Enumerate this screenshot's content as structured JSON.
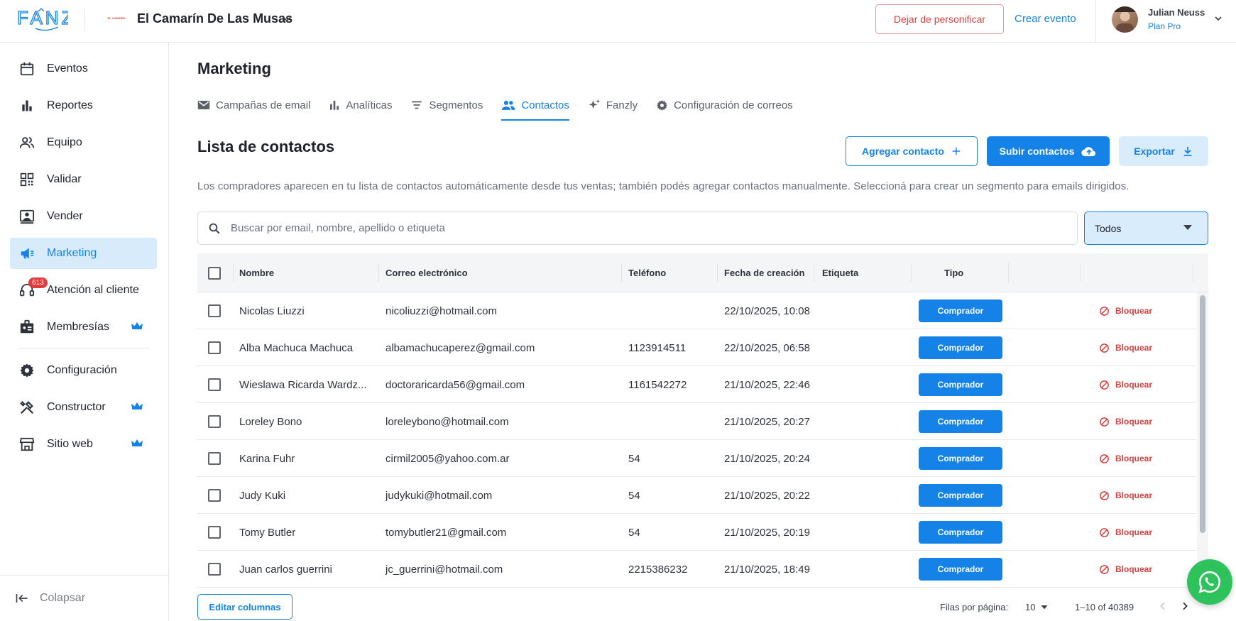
{
  "app": {
    "logo": "FANZ"
  },
  "topbar": {
    "venue_logo_text": "EL CAMARÍN",
    "venue_name": "El Camarín De Las Musas",
    "stop_impersonate_label": "Dejar de personificar",
    "create_event_label": "Crear evento",
    "user_name": "Julian Neuss",
    "user_plan": "Plan Pro"
  },
  "sidebar": {
    "items": [
      {
        "label": "Eventos",
        "icon": "calendar-icon"
      },
      {
        "label": "Reportes",
        "icon": "bar-chart-icon"
      },
      {
        "label": "Equipo",
        "icon": "people-icon"
      },
      {
        "label": "Validar",
        "icon": "qr-code-icon"
      },
      {
        "label": "Vender",
        "icon": "cashier-icon"
      },
      {
        "label": "Marketing",
        "icon": "megaphone-icon",
        "active": true
      },
      {
        "label": "Atención al cliente",
        "icon": "support-icon",
        "badge": "613"
      },
      {
        "label": "Membresías",
        "icon": "badge-icon",
        "crown": true
      },
      {
        "label": "Configuración",
        "icon": "gear-icon"
      },
      {
        "label": "Constructor",
        "icon": "tools-icon",
        "crown": true
      },
      {
        "label": "Sitio web",
        "icon": "store-icon",
        "crown": true
      }
    ],
    "collapse_label": "Colapsar"
  },
  "main": {
    "title": "Marketing",
    "tabs": [
      {
        "label": "Campañas de email",
        "icon": "mail-icon"
      },
      {
        "label": "Analíticas",
        "icon": "bar-chart-icon"
      },
      {
        "label": "Segmentos",
        "icon": "filter-icon"
      },
      {
        "label": "Contactos",
        "icon": "contacts-icon",
        "active": true
      },
      {
        "label": "Fanzly",
        "icon": "sparkle-icon"
      },
      {
        "label": "Configuración de correos",
        "icon": "gear-icon"
      }
    ],
    "section_title": "Lista de contactos",
    "add_contact_label": "Agregar contacto",
    "upload_contacts_label": "Subir contactos",
    "export_label": "Exportar",
    "description": "Los compradores aparecen en tu lista de contactos automáticamente desde tus ventas; también podés agregar contactos manualmente. Seleccioná para crear un segmento para emails dirigidos.",
    "search": {
      "placeholder": "Buscar por email, nombre, apellido o etiqueta",
      "value": ""
    },
    "filter": {
      "selected": "Todos"
    }
  },
  "table": {
    "columns": [
      "Nombre",
      "Correo electrónico",
      "Teléfono",
      "Fecha de creación",
      "Etiqueta",
      "Tipo"
    ],
    "rows": [
      {
        "name": "Nicolas Liuzzi",
        "email": "nicoliuzzi@hotmail.com",
        "phone": "",
        "created": "22/10/2025, 10:08",
        "tag": "",
        "type": "Comprador",
        "action": "Bloquear"
      },
      {
        "name": "Alba Machuca Machuca",
        "email": "albamachucaperez@gmail.com",
        "phone": "1123914511",
        "created": "22/10/2025, 06:58",
        "tag": "",
        "type": "Comprador",
        "action": "Bloquear"
      },
      {
        "name": "Wieslawa Ricarda Wardz...",
        "email": "doctoraricarda56@gmail.com",
        "phone": "1161542272",
        "created": "21/10/2025, 22:46",
        "tag": "",
        "type": "Comprador",
        "action": "Bloquear"
      },
      {
        "name": "Loreley Bono",
        "email": "loreleybono@hotmail.com",
        "phone": "",
        "created": "21/10/2025, 20:27",
        "tag": "",
        "type": "Comprador",
        "action": "Bloquear"
      },
      {
        "name": "Karina Fuhr",
        "email": "cirmil2005@yahoo.com.ar",
        "phone": "54",
        "created": "21/10/2025, 20:24",
        "tag": "",
        "type": "Comprador",
        "action": "Bloquear"
      },
      {
        "name": "Judy Kuki",
        "email": "judykuki@hotmail.com",
        "phone": "54",
        "created": "21/10/2025, 20:22",
        "tag": "",
        "type": "Comprador",
        "action": "Bloquear"
      },
      {
        "name": "Tomy Butler",
        "email": "tomybutler21@gmail.com",
        "phone": "54",
        "created": "21/10/2025, 20:19",
        "tag": "",
        "type": "Comprador",
        "action": "Bloquear"
      },
      {
        "name": "Juan carlos guerrini",
        "email": "jc_guerrini@hotmail.com",
        "phone": "2215386232",
        "created": "21/10/2025, 18:49",
        "tag": "",
        "type": "Comprador",
        "action": "Bloquear"
      }
    ]
  },
  "footer": {
    "edit_columns_label": "Editar columnas",
    "rows_per_page_label": "Filas por página:",
    "rows_per_page": "10",
    "range": "1–10 of 40389"
  },
  "colors": {
    "accent": "#1482e6",
    "danger": "#d64141",
    "whatsapp": "#2ec25c"
  }
}
